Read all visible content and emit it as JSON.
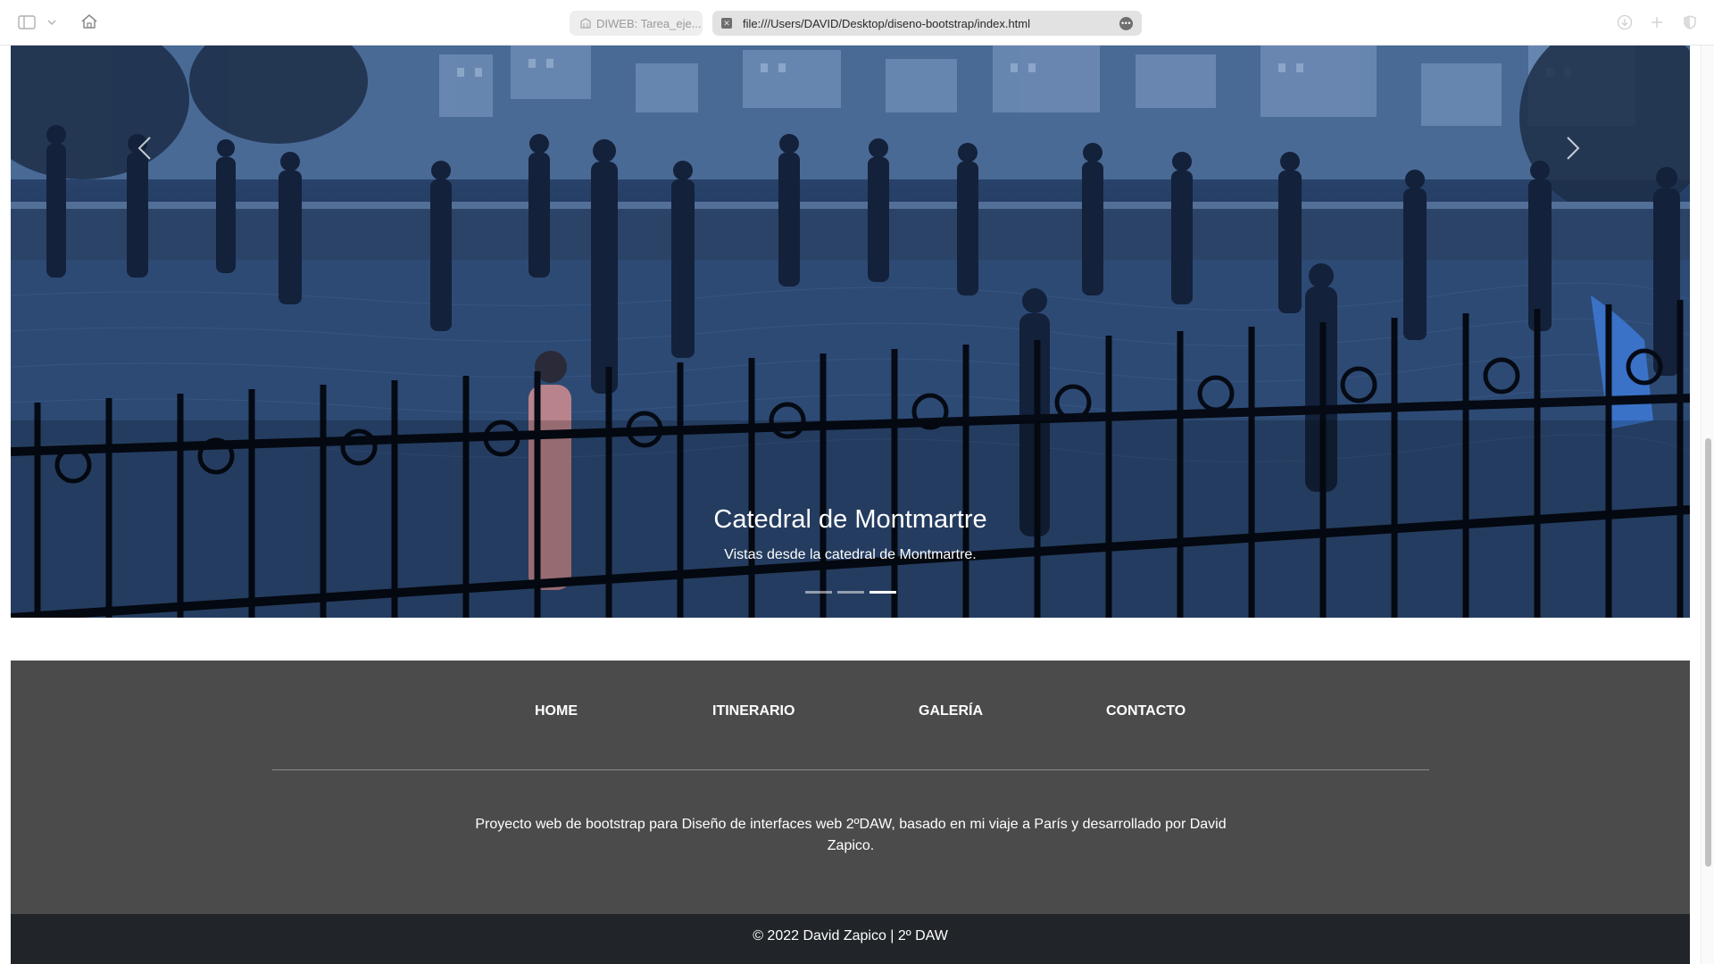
{
  "browser": {
    "tabs": [
      {
        "label": "DIWEB: Tarea_eje..."
      }
    ],
    "url": "file:///Users/DAVID/Desktop/diseno-bootstrap/index.html",
    "icons": {
      "sidebar": "sidebar-icon",
      "chevron": "chevron-down-icon",
      "home": "home-icon",
      "download": "download-icon",
      "new_tab": "plus-icon",
      "privacy": "shield-icon"
    }
  },
  "carousel": {
    "caption_title": "Catedral de Montmartre",
    "caption_text": "Vistas desde la catedral de Montmartre.",
    "slide_count": 3,
    "active_slide": 3,
    "icons": {
      "prev": "chevron-left-icon",
      "next": "chevron-right-icon"
    }
  },
  "footer": {
    "nav": [
      {
        "label": "HOME"
      },
      {
        "label": "ITINERARIO"
      },
      {
        "label": "GALERÍA"
      },
      {
        "label": "CONTACTO"
      }
    ],
    "description": "Proyecto web de bootstrap para Diseño de interfaces web 2ºDAW, basado en mi viaje a París y desarrollado por David Zapico.",
    "copyright": "© 2022 David Zapico | 2º DAW"
  },
  "colors": {
    "footer_bg": "#4b4b4b",
    "copyright_bg": "#212529",
    "text": "#ffffff"
  }
}
